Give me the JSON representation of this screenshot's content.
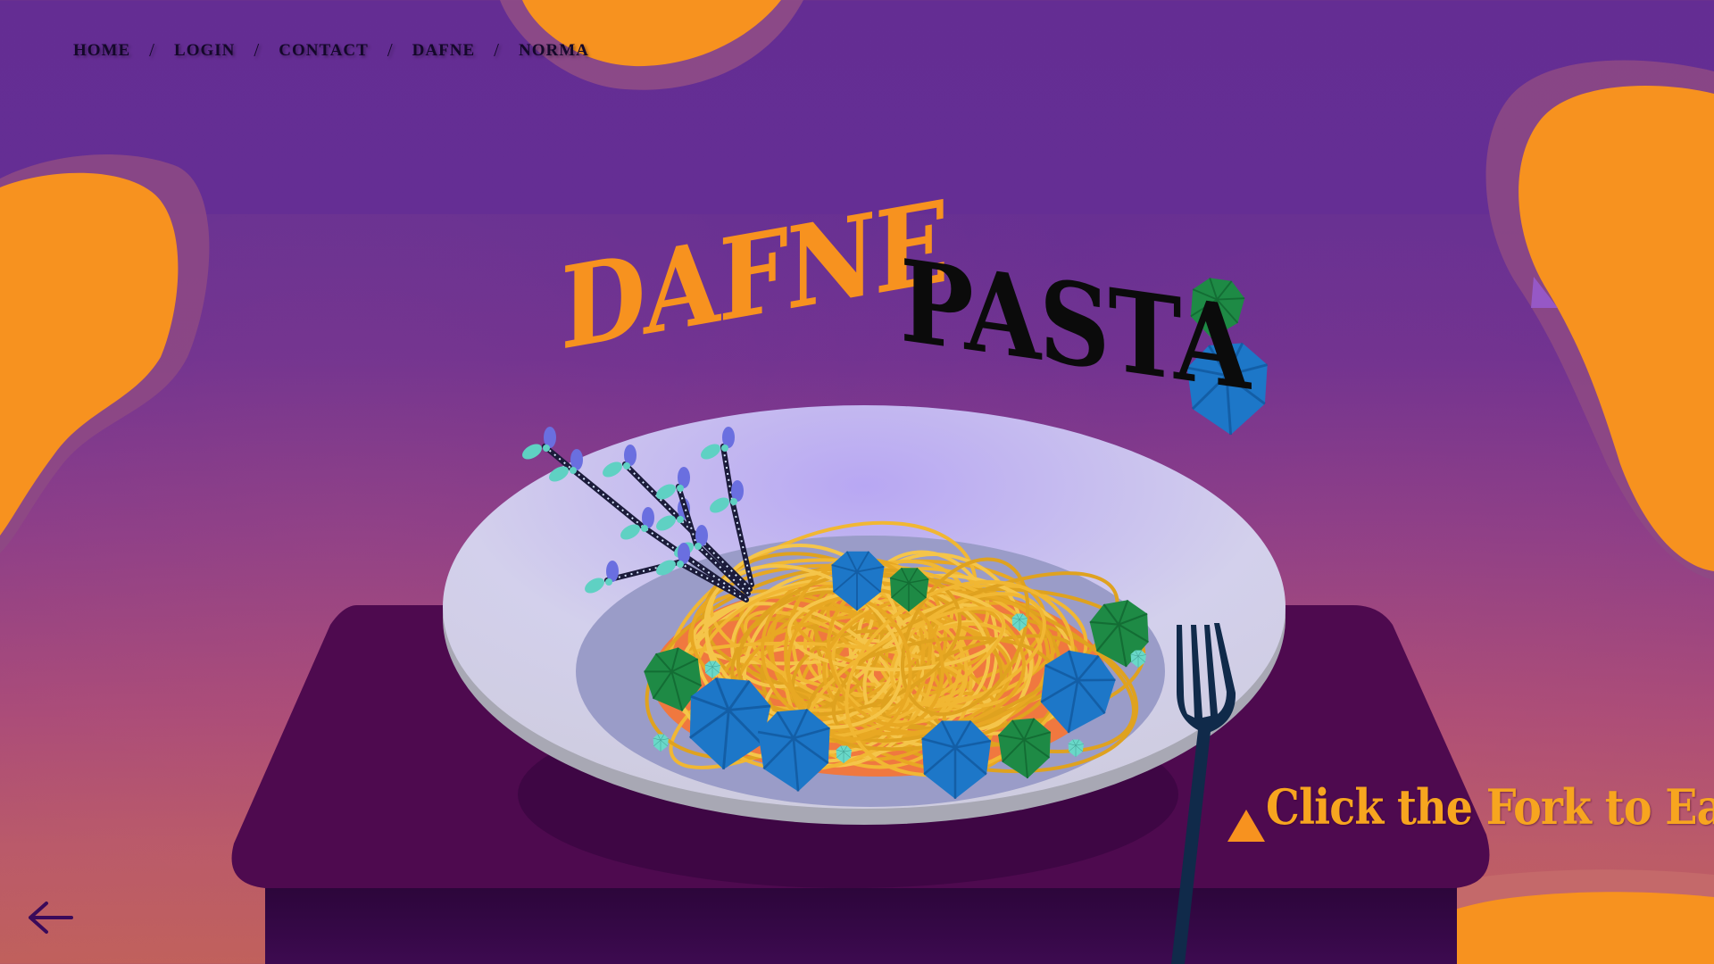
{
  "nav": {
    "items": [
      "HOME",
      "LOGIN",
      "CONTACT",
      "DAFNE",
      "NORMA"
    ],
    "separator": "/"
  },
  "title": {
    "word1": "DAFNE",
    "word2": "PASTA"
  },
  "cta": {
    "label": "Click the Fork to Eat"
  },
  "icons": {
    "back": "arrow-left-icon",
    "cta": "triangle-pointer-icon",
    "fork": "fork-icon"
  },
  "colors": {
    "background": "#642d93",
    "orange": "#f7921f",
    "table": "#4e0a4f",
    "plate": "#d2d0ec",
    "pasta": "#f1b733",
    "sauce": "#f0783f",
    "sapphire": "#1d77c8",
    "emerald": "#1e8a45",
    "fork": "#102a4a"
  }
}
